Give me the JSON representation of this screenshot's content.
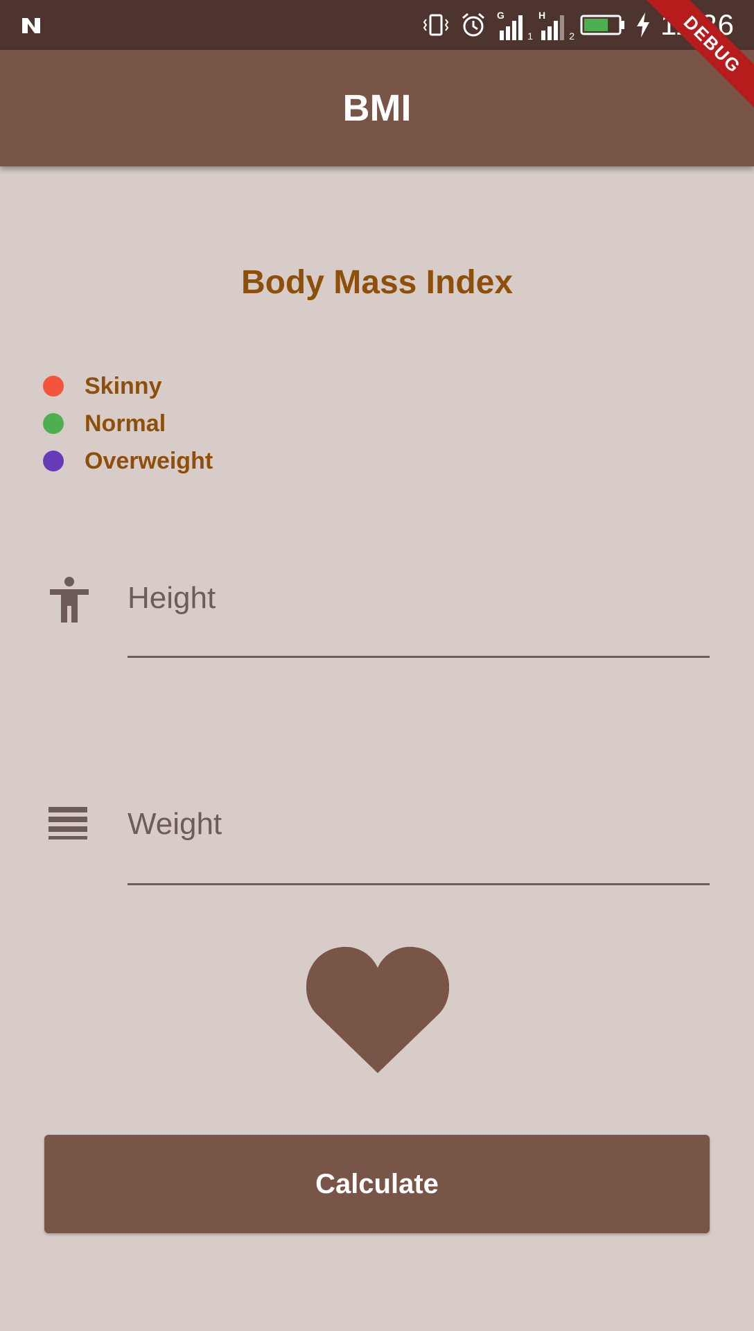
{
  "status_bar": {
    "time": "11:26",
    "sim1_label": "G",
    "sim1_index": "1",
    "sim2_label": "H",
    "sim2_index": "2"
  },
  "app_bar": {
    "title": "BMI",
    "debug_label": "DEBUG"
  },
  "heading": "Body Mass Index",
  "legend": [
    {
      "label": "Skinny",
      "color": "#f4543b"
    },
    {
      "label": "Normal",
      "color": "#4caf50"
    },
    {
      "label": "Overweight",
      "color": "#673ab7"
    }
  ],
  "height_field": {
    "placeholder": "Height",
    "icon": "accessibility-icon"
  },
  "weight_field": {
    "placeholder": "Weight",
    "icon": "weight-icon"
  },
  "heart_icon": "heart-icon",
  "calculate_button": {
    "label": "Calculate"
  },
  "colors": {
    "primary": "#795548",
    "status": "#4e342e",
    "accent_text": "#8d4f0a",
    "background": "#d7ccc8"
  }
}
